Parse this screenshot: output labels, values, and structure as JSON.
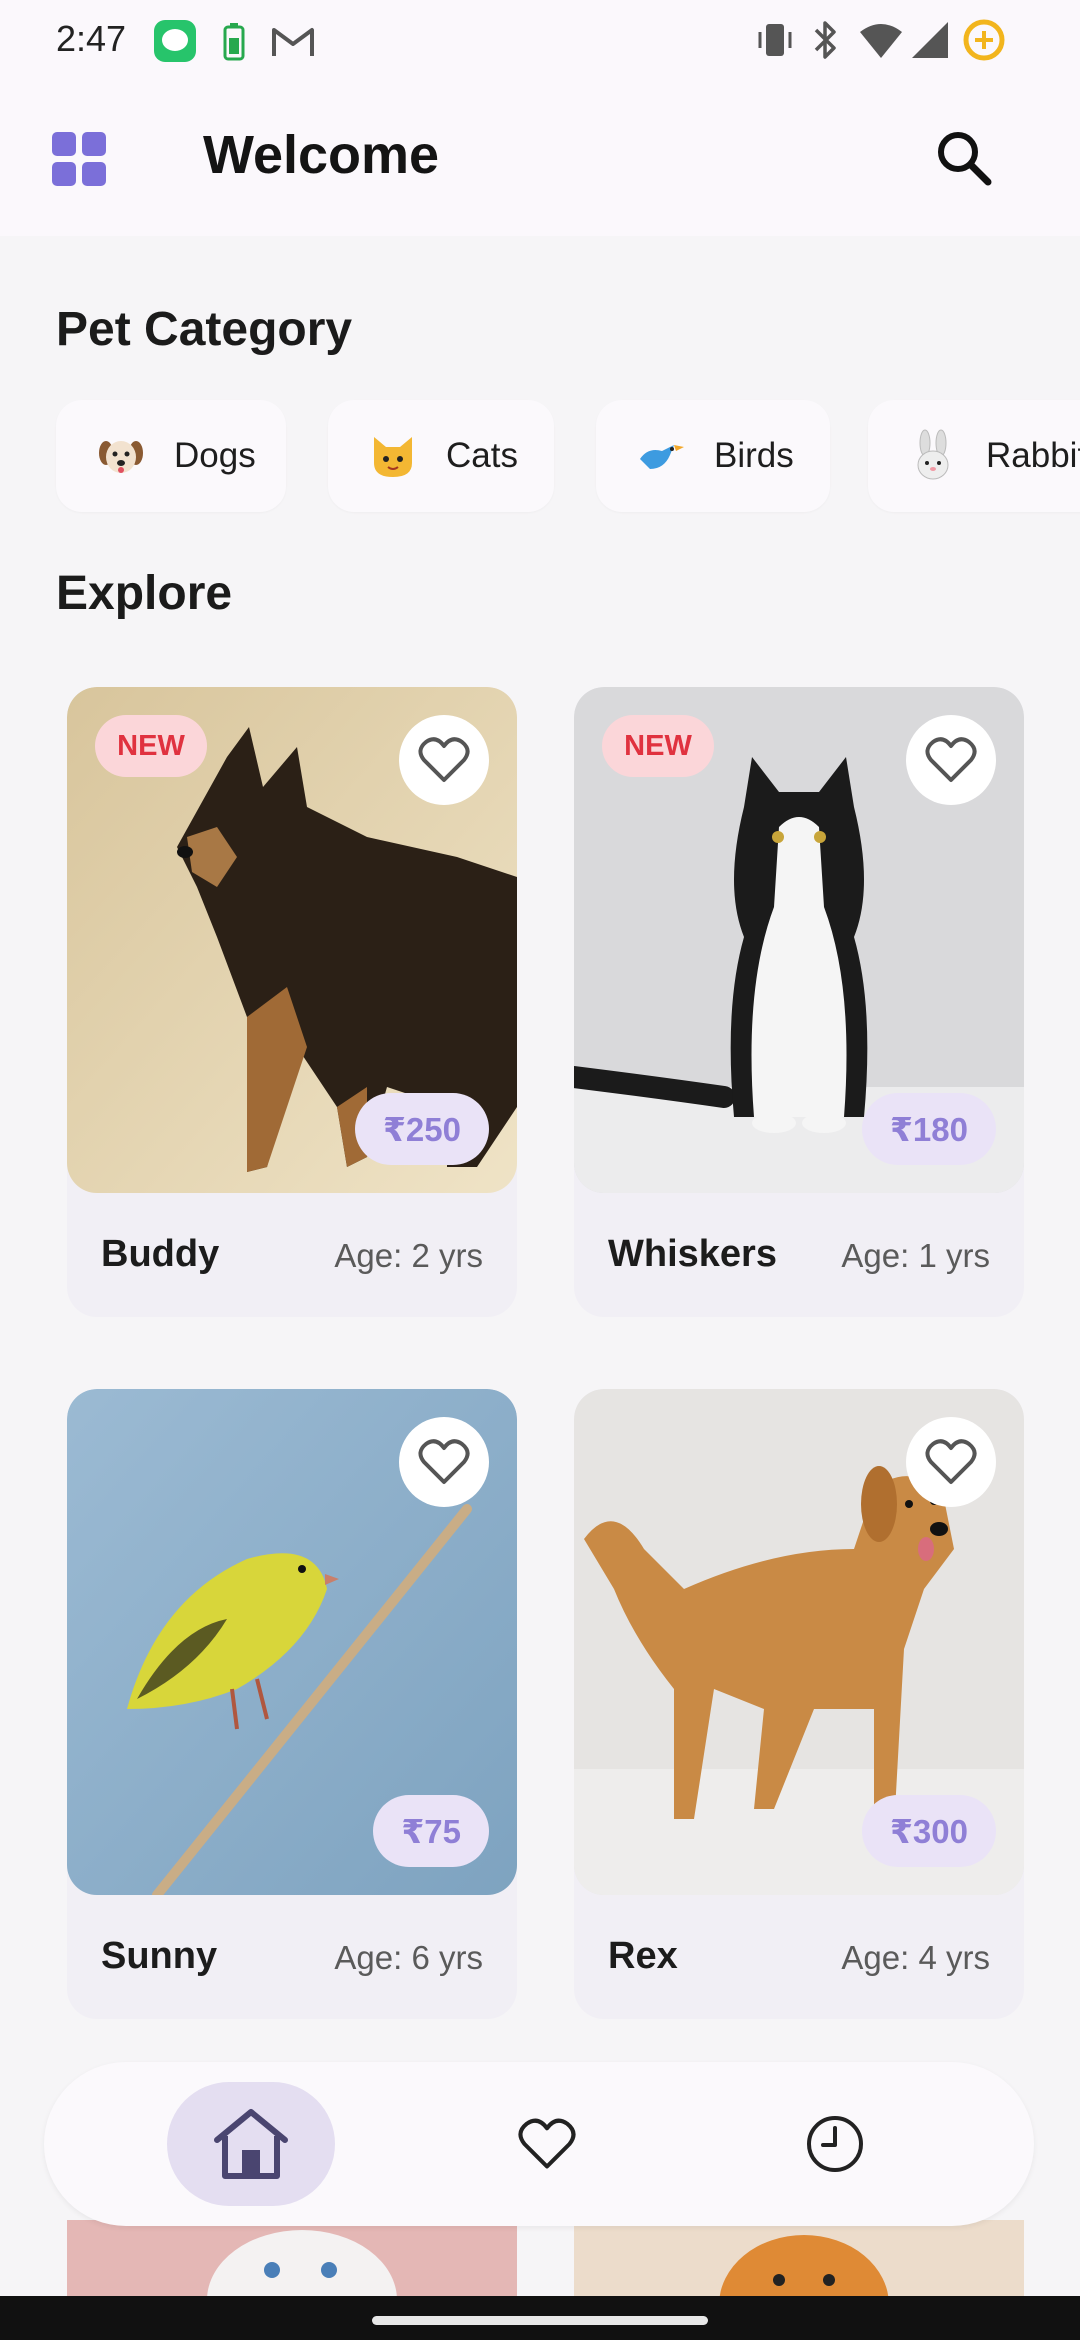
{
  "status_bar": {
    "time": "2:47"
  },
  "header": {
    "title": "Welcome"
  },
  "categories": {
    "title": "Pet Category",
    "items": [
      {
        "label": "Dogs",
        "icon": "dog-face-icon"
      },
      {
        "label": "Cats",
        "icon": "cat-face-icon"
      },
      {
        "label": "Birds",
        "icon": "bird-icon"
      },
      {
        "label": "Rabbit",
        "icon": "rabbit-face-icon"
      }
    ]
  },
  "explore": {
    "title": "Explore",
    "pets": [
      {
        "name": "Buddy",
        "age": "Age: 2 yrs",
        "price": "₹250",
        "badge": "NEW"
      },
      {
        "name": "Whiskers",
        "age": "Age: 1 yrs",
        "price": "₹180",
        "badge": "NEW"
      },
      {
        "name": "Sunny",
        "age": "Age: 6 yrs",
        "price": "₹75"
      },
      {
        "name": "Rex",
        "age": "Age: 4 yrs",
        "price": "₹300"
      }
    ]
  },
  "bottom_nav": {
    "items": [
      {
        "name": "home",
        "icon": "home-icon",
        "active": true
      },
      {
        "name": "favorites",
        "icon": "heart-icon"
      },
      {
        "name": "history",
        "icon": "clock-icon"
      }
    ]
  },
  "colors": {
    "accent": "#7b6fd9",
    "price_text": "#8f7fd6",
    "new_badge_text": "#e0323f",
    "new_badge_bg": "#fbd6d9"
  }
}
